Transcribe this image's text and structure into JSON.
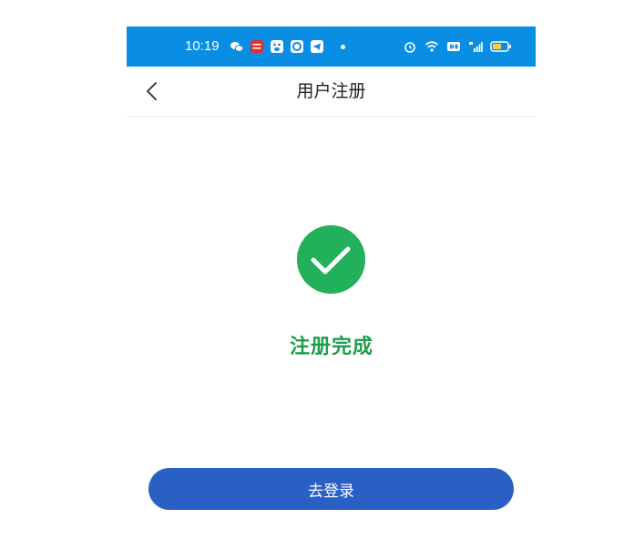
{
  "status_bar": {
    "time": "10:19",
    "left_icons": [
      "wechat-icon",
      "jd-app-icon",
      "baidu-icon",
      "qq-browser-icon",
      "telegram-icon",
      "more-notifications-dot"
    ],
    "right_icons": [
      "alarm-icon",
      "wifi-icon",
      "hd-icon",
      "signal-4g-icon",
      "battery-icon"
    ],
    "background_color": "#0a8ee3"
  },
  "navbar": {
    "title": "用户注册",
    "back_icon": "chevron-left-icon"
  },
  "result": {
    "icon": "check-circle-icon",
    "icon_color": "#22b05b",
    "message": "注册完成",
    "message_color": "#1e9e4e"
  },
  "actions": {
    "login_button_label": "去登录",
    "button_color": "#2a60c4"
  }
}
